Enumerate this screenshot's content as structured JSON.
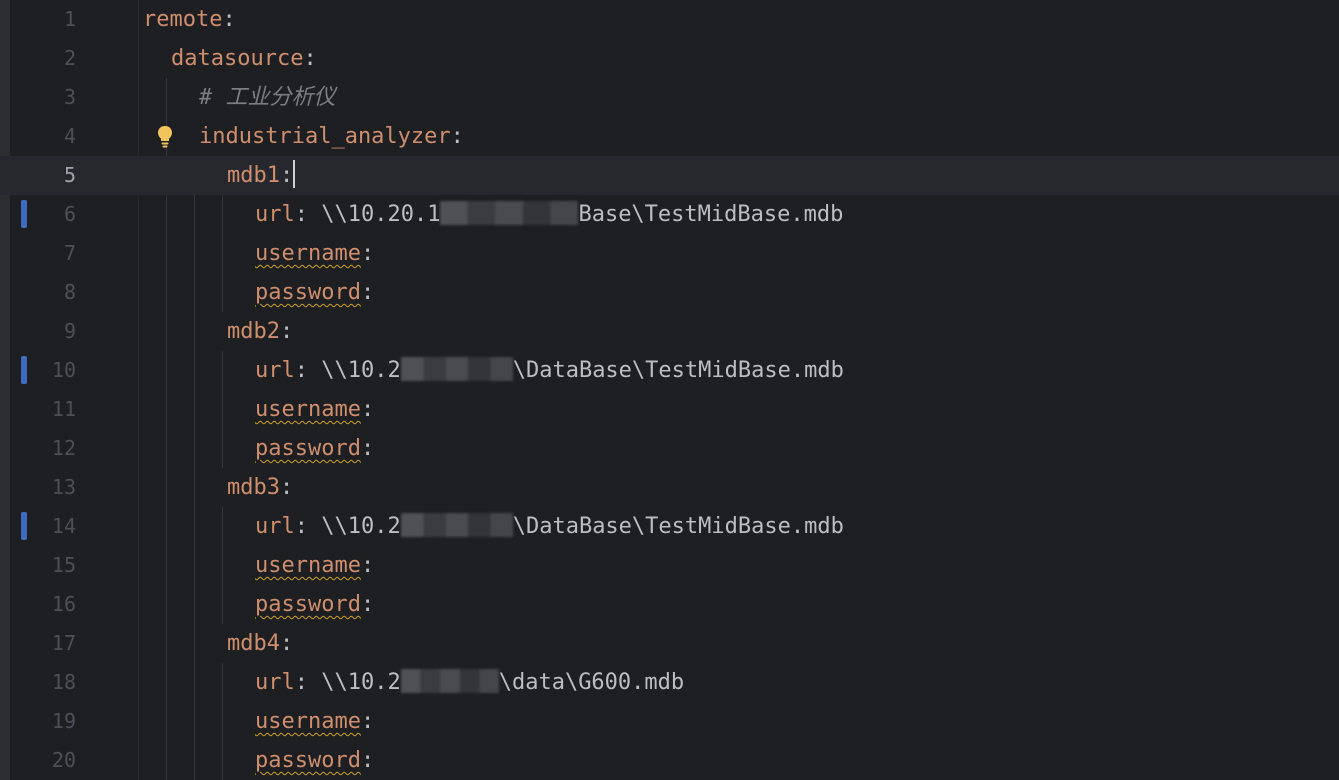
{
  "editor": {
    "lines": [
      {
        "num": "1",
        "key": "remote",
        "colon": ":"
      },
      {
        "num": "2",
        "key": "datasource",
        "colon": ":"
      },
      {
        "num": "3",
        "comment": "# 工业分析仪"
      },
      {
        "num": "4",
        "key": "industrial_analyzer",
        "colon": ":"
      },
      {
        "num": "5",
        "key": "mdb1",
        "colon": ":"
      },
      {
        "num": "6",
        "key": "url",
        "colon": ":",
        "value_prefix": " \\\\10.20.1",
        "value_suffix": "Base\\TestMidBase.mdb"
      },
      {
        "num": "7",
        "key": "username",
        "colon": ":"
      },
      {
        "num": "8",
        "key": "password",
        "colon": ":"
      },
      {
        "num": "9",
        "key": "mdb2",
        "colon": ":"
      },
      {
        "num": "10",
        "key": "url",
        "colon": ":",
        "value_prefix": " \\\\10.2",
        "value_suffix": "\\DataBase\\TestMidBase.mdb"
      },
      {
        "num": "11",
        "key": "username",
        "colon": ":"
      },
      {
        "num": "12",
        "key": "password",
        "colon": ":"
      },
      {
        "num": "13",
        "key": "mdb3",
        "colon": ":"
      },
      {
        "num": "14",
        "key": "url",
        "colon": ":",
        "value_prefix": " \\\\10.2",
        "value_suffix": "\\DataBase\\TestMidBase.mdb"
      },
      {
        "num": "15",
        "key": "username",
        "colon": ":"
      },
      {
        "num": "16",
        "key": "password",
        "colon": ":"
      },
      {
        "num": "17",
        "key": "mdb4",
        "colon": ":"
      },
      {
        "num": "18",
        "key": "url",
        "colon": ":",
        "value_prefix": " \\\\10.2",
        "value_suffix": "\\data\\G600.mdb"
      },
      {
        "num": "19",
        "key": "username",
        "colon": ":"
      },
      {
        "num": "20",
        "key": "password",
        "colon": ":"
      }
    ]
  },
  "colors": {
    "background": "#1e1f22",
    "key": "#cf8e6d",
    "text": "#bcbec4",
    "comment": "#7a7e85",
    "line_number": "#4b5059",
    "change_marker": "#3d6bc2",
    "warning_underline": "#c9a227",
    "bulb": "#f2c55c"
  },
  "icons": {
    "gutter_line4": "lightbulb-icon"
  }
}
